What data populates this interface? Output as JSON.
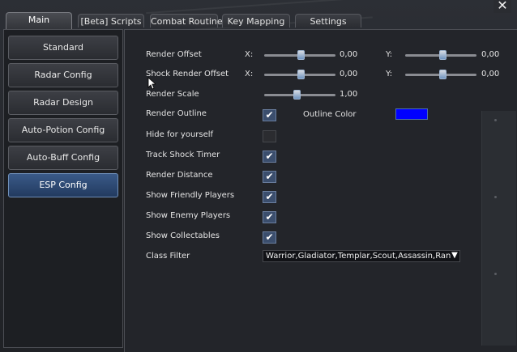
{
  "tabs": [
    {
      "label": "Main",
      "active": true
    },
    {
      "label": "[Beta] Scripts",
      "active": false
    },
    {
      "label": "Combat Routine",
      "active": false
    },
    {
      "label": "Key Mapping",
      "active": false
    },
    {
      "label": "Settings",
      "active": false
    }
  ],
  "close_label": "✕",
  "sidebar": {
    "items": [
      {
        "label": "Standard",
        "active": false
      },
      {
        "label": "Radar Config",
        "active": false
      },
      {
        "label": "Radar Design",
        "active": false
      },
      {
        "label": "Auto-Potion Config",
        "active": false
      },
      {
        "label": "Auto-Buff Config",
        "active": false
      },
      {
        "label": "ESP Config",
        "active": true
      }
    ]
  },
  "esp": {
    "render_offset": {
      "label": "Render Offset",
      "x_label": "X:",
      "x_value": "0,00",
      "y_label": "Y:",
      "y_value": "0,00"
    },
    "shock_render_offset": {
      "label": "Shock Render Offset",
      "x_label": "X:",
      "x_value": "0,00",
      "y_label": "Y:",
      "y_value": "0,00"
    },
    "render_scale": {
      "label": "Render Scale",
      "value": "1,00"
    },
    "render_outline": {
      "label": "Render Outline",
      "checked": true,
      "outline_color_label": "Outline Color",
      "outline_color": "#0000ff"
    },
    "hide_for_yourself": {
      "label": "Hide for yourself",
      "checked": false
    },
    "track_shock_timer": {
      "label": "Track Shock Timer",
      "checked": true
    },
    "render_distance": {
      "label": "Render Distance",
      "checked": true
    },
    "show_friendly_players": {
      "label": "Show Friendly Players",
      "checked": true
    },
    "show_enemy_players": {
      "label": "Show Enemy Players",
      "checked": true
    },
    "show_collectables": {
      "label": "Show Collectables",
      "checked": true
    },
    "class_filter": {
      "label": "Class Filter",
      "value": "Warrior,Gladiator,Templar,Scout,Assassin,Ran"
    }
  },
  "colors": {
    "accent": "#3a5a88",
    "outline_color": "#0000ff"
  },
  "icons": {
    "close": "close-icon",
    "check": "checkmark-icon",
    "dropdown": "chevron-down-icon"
  }
}
